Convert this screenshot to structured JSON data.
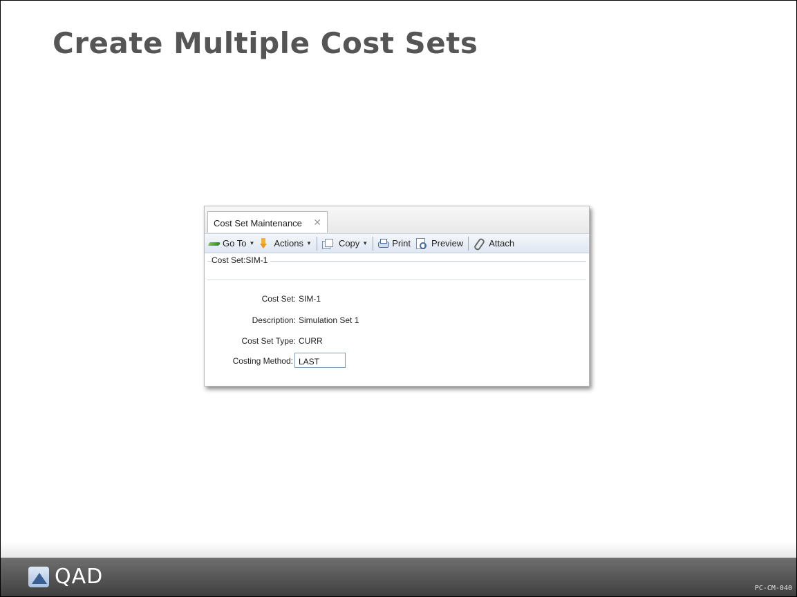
{
  "slide": {
    "title": "Create Multiple Cost Sets",
    "code": "PC-CM-040"
  },
  "app": {
    "tab": {
      "label": "Cost Set Maintenance",
      "close_glyph": "✕"
    },
    "toolbar": {
      "goto_label": "Go To",
      "actions_label": "Actions",
      "copy_label": "Copy",
      "print_label": "Print",
      "preview_label": "Preview",
      "attach_label": "Attach",
      "caret": "▼",
      "icons": [
        "goto-icon",
        "actions-icon",
        "copy-icon",
        "print-icon",
        "preview-icon",
        "attach-icon"
      ]
    },
    "breadcrumb": "Cost Set:SIM-1",
    "form": {
      "cost_set_label": "Cost Set:",
      "cost_set_value": "SIM-1",
      "description_label": "Description:",
      "description_value": "Simulation Set 1",
      "type_label": "Cost Set Type:",
      "type_value": "CURR",
      "method_label": "Costing Method:",
      "method_value": "LAST"
    }
  },
  "footer": {
    "logo_text": "QAD"
  },
  "colors": {
    "title": "#555555",
    "footer": "#4f4f4f",
    "toolbar": "#dfe7f2"
  }
}
